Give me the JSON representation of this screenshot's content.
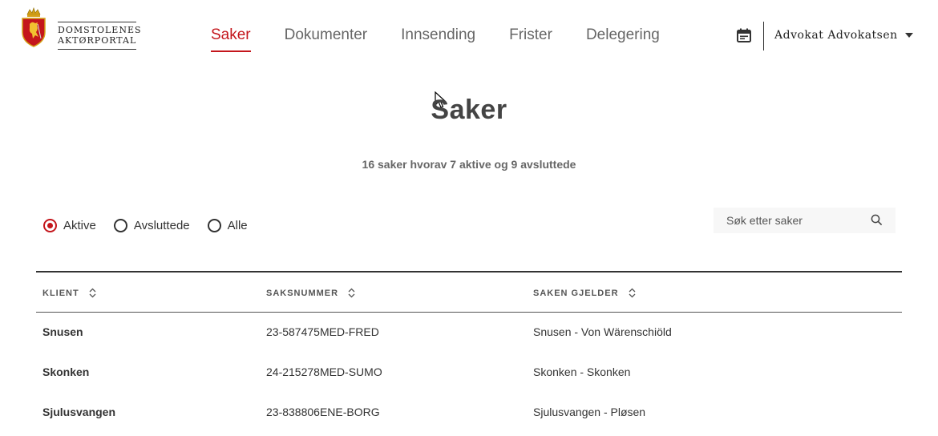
{
  "logo": {
    "line1": "DOMSTOLENES",
    "line2": "AKTØRPORTAL"
  },
  "nav": {
    "items": [
      {
        "label": "Saker",
        "active": true
      },
      {
        "label": "Dokumenter",
        "active": false
      },
      {
        "label": "Innsending",
        "active": false
      },
      {
        "label": "Frister",
        "active": false
      },
      {
        "label": "Delegering",
        "active": false
      }
    ]
  },
  "user": {
    "name": "Advokat Advokatsen"
  },
  "page": {
    "title": "Saker",
    "summary": "16 saker hvorav 7 aktive og 9 avsluttede"
  },
  "filters": {
    "options": [
      {
        "label": "Aktive",
        "checked": true
      },
      {
        "label": "Avsluttede",
        "checked": false
      },
      {
        "label": "Alle",
        "checked": false
      }
    ]
  },
  "search": {
    "placeholder": "Søk etter saker",
    "value": ""
  },
  "table": {
    "headers": [
      "KLIENT",
      "SAKSNUMMER",
      "SAKEN GJELDER"
    ],
    "rows": [
      {
        "client": "Snusen",
        "case_number": "23-587475MED-FRED",
        "subject": "Snusen - Von Wärenschiöld"
      },
      {
        "client": "Skonken",
        "case_number": "24-215278MED-SUMO",
        "subject": "Skonken - Skonken"
      },
      {
        "client": "Sjulusvangen",
        "case_number": "23-838806ENE-BORG",
        "subject": "Sjulusvangen - Pløsen"
      }
    ]
  },
  "colors": {
    "accent": "#c4161c",
    "text": "#333333",
    "muted": "#666666"
  }
}
